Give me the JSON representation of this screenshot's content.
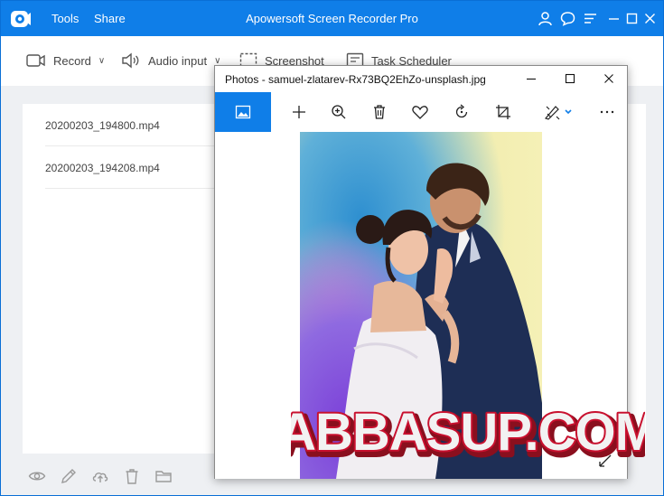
{
  "app": {
    "title": "Apowersoft Screen Recorder Pro",
    "menus": [
      "Tools",
      "Share"
    ],
    "titlebar_icons": [
      "user-icon",
      "chat-icon",
      "menu-icon",
      "minimize-icon",
      "maximize-icon",
      "close-icon"
    ]
  },
  "toolbar": {
    "record_label": "Record",
    "audio_label": "Audio input",
    "screenshot_label": "Screenshot",
    "scheduler_label": "Task Scheduler"
  },
  "files": [
    {
      "name": "20200203_194800.mp4"
    },
    {
      "name": "20200203_194208.mp4"
    }
  ],
  "bottom_tools": [
    "eye-icon",
    "pencil-icon",
    "cloud-upload-icon",
    "trash-icon",
    "folder-icon"
  ],
  "photos": {
    "title": "Photos - samuel-zlatarev-Rx73BQ2EhZo-unsplash.jpg",
    "tools": [
      "add-icon",
      "zoom-in-icon",
      "trash-icon",
      "heart-icon",
      "rotate-icon",
      "crop-icon",
      "edit-icon",
      "more-icon"
    ]
  },
  "watermark": {
    "text": "ABBASUP.COM"
  },
  "colors": {
    "accent": "#0f7ee8",
    "workarea": "#eef0f3",
    "watermark_fill": "#f2f2f2",
    "watermark_outline": "#c8102e"
  }
}
